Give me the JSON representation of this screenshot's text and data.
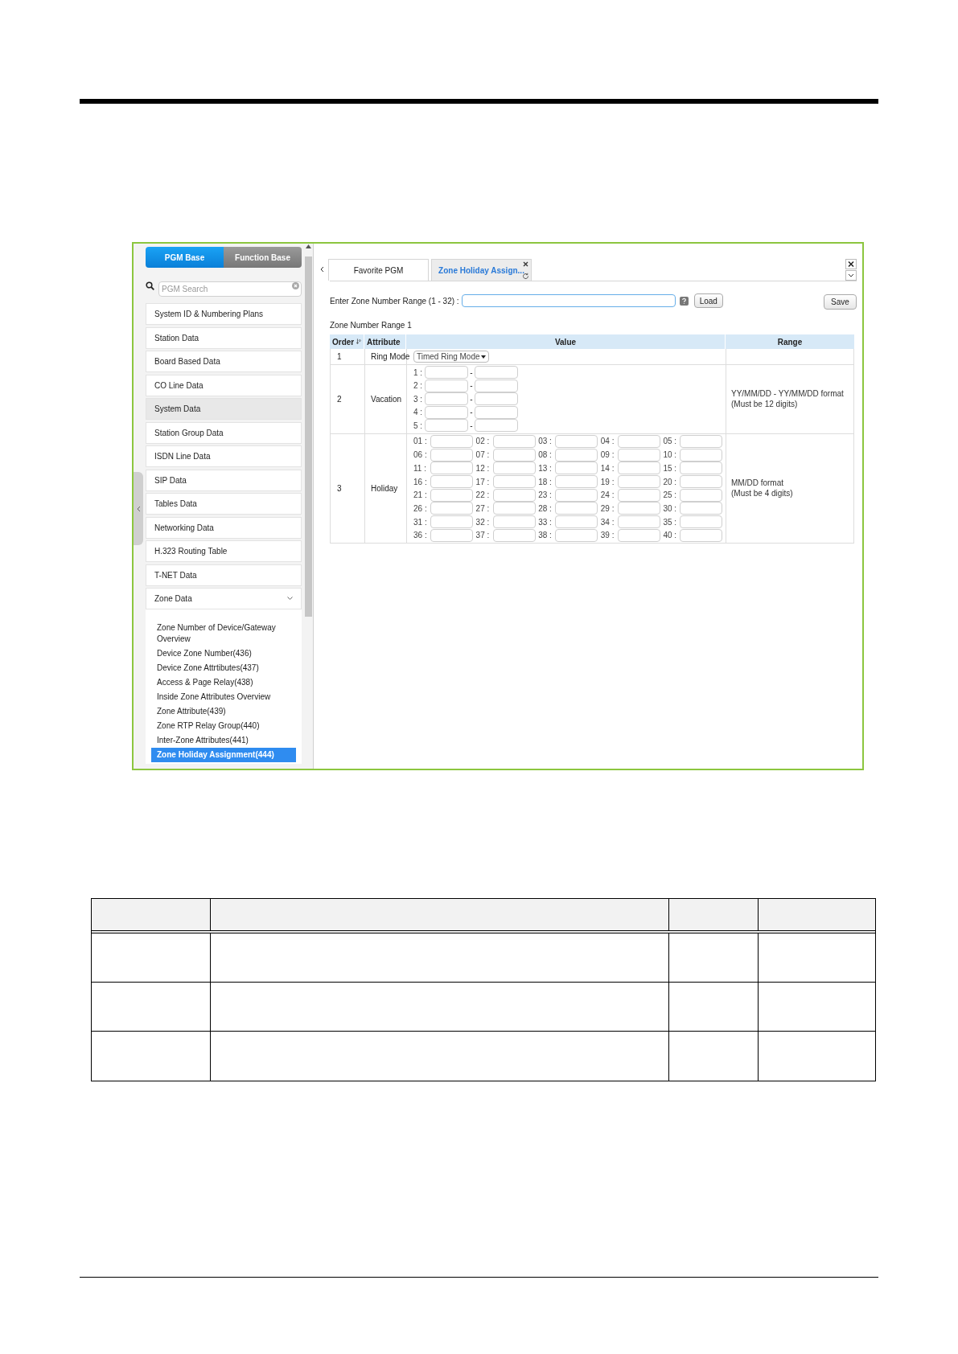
{
  "sidebar": {
    "mode_tabs": [
      {
        "label": "PGM Base",
        "selected": true
      },
      {
        "label": "Function Base",
        "selected": false
      }
    ],
    "search": {
      "placeholder": "PGM Search"
    },
    "items": [
      {
        "label": "System ID & Numbering Plans",
        "highlighted": false
      },
      {
        "label": "Station Data",
        "highlighted": false
      },
      {
        "label": "Board Based Data",
        "highlighted": false
      },
      {
        "label": "CO Line Data",
        "highlighted": false
      },
      {
        "label": "System Data",
        "highlighted": true
      },
      {
        "label": "Station Group Data",
        "highlighted": false
      },
      {
        "label": "ISDN Line Data",
        "highlighted": false
      },
      {
        "label": "SIP Data",
        "highlighted": false
      },
      {
        "label": "Tables Data",
        "highlighted": false
      },
      {
        "label": "Networking Data",
        "highlighted": false
      },
      {
        "label": "H.323 Routing Table",
        "highlighted": false
      },
      {
        "label": "T-NET Data",
        "highlighted": false
      },
      {
        "label": "Zone Data",
        "highlighted": false,
        "expanded": true,
        "children": [
          {
            "label": "Zone Number of Device/Gateway Overview",
            "selected": false
          },
          {
            "label": "Device Zone Number(436)",
            "selected": false
          },
          {
            "label": "Device Zone Attrtibutes(437)",
            "selected": false
          },
          {
            "label": "Access & Page Relay(438)",
            "selected": false
          },
          {
            "label": "Inside Zone Attributes Overview",
            "selected": false
          },
          {
            "label": "Zone Attribute(439)",
            "selected": false
          },
          {
            "label": "Zone RTP Relay Group(440)",
            "selected": false
          },
          {
            "label": "Inter-Zone Attributes(441)",
            "selected": false
          },
          {
            "label": "Zone Holiday Assignment(444)",
            "selected": true
          }
        ]
      }
    ]
  },
  "tabs": [
    {
      "label": "Favorite PGM",
      "selected": false
    },
    {
      "label": "Zone Holiday Assign...",
      "selected": true
    }
  ],
  "range_field": {
    "label": "Enter Zone Number Range (1 - 32) :"
  },
  "buttons": {
    "load": "Load",
    "save": "Save"
  },
  "section_title": "Zone Number Range 1",
  "table": {
    "columns": [
      "Order",
      "Attribute",
      "Value",
      "Range"
    ],
    "rows": [
      {
        "order": "1",
        "attribute": "Ring Mode",
        "kind": "select",
        "value": "Timed Ring Mode"
      },
      {
        "order": "2",
        "attribute": "Vacation",
        "kind": "ranges",
        "slots": [
          "1 :",
          "2 :",
          "3 :",
          "4 :",
          "5 :"
        ],
        "separator": "-",
        "range": [
          "YY/MM/DD - YY/MM/DD format",
          "(Must be 12 digits)"
        ]
      },
      {
        "order": "3",
        "attribute": "Holiday",
        "kind": "grid",
        "slots": [
          "01 :",
          "02 :",
          "03 :",
          "04 :",
          "05 :",
          "06 :",
          "07 :",
          "08 :",
          "09 :",
          "10 :",
          "11 :",
          "12 :",
          "13 :",
          "14 :",
          "15 :",
          "16 :",
          "17 :",
          "18 :",
          "19 :",
          "20 :",
          "21 :",
          "22 :",
          "23 :",
          "24 :",
          "25 :",
          "26 :",
          "27 :",
          "28 :",
          "29 :",
          "30 :",
          "31 :",
          "32 :",
          "33 :",
          "34 :",
          "35 :",
          "36 :",
          "37 :",
          "38 :",
          "39 :",
          "40 :"
        ],
        "range": [
          "MM/DD format",
          "(Must be 4 digits)"
        ]
      }
    ]
  }
}
